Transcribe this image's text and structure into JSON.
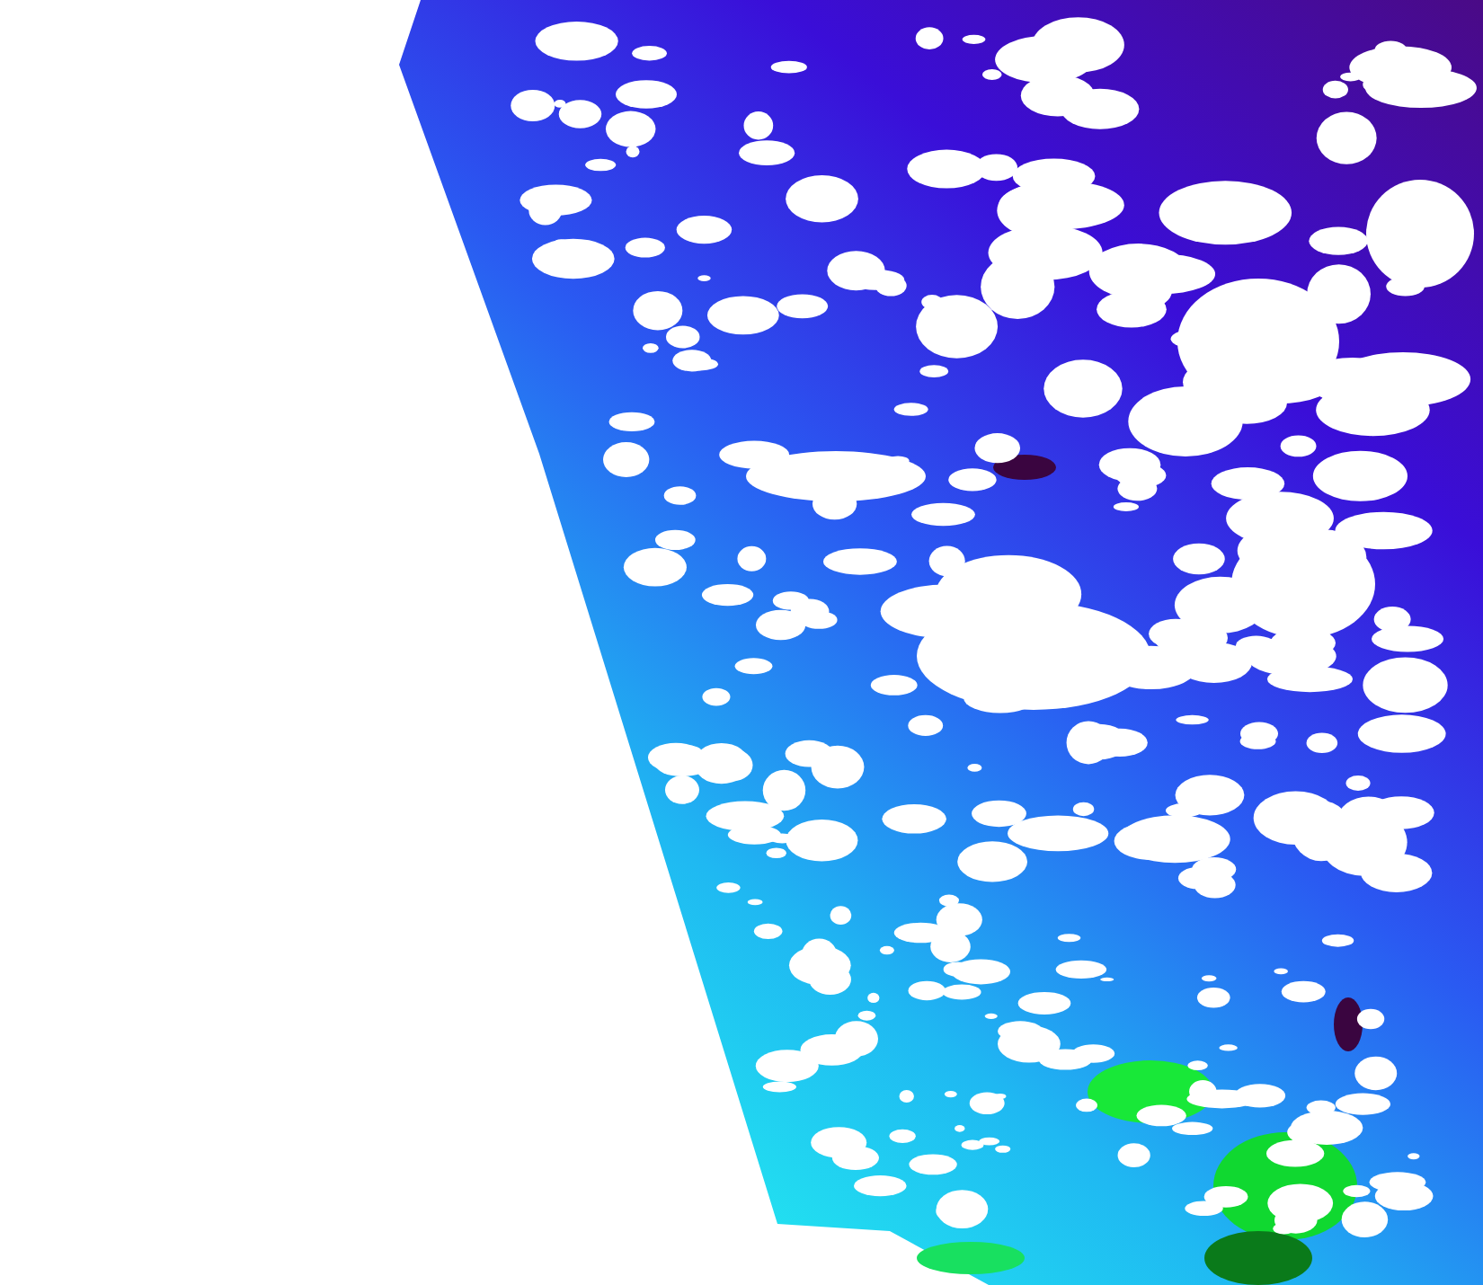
{
  "image": {
    "kind": "satellite-swath"
  }
}
